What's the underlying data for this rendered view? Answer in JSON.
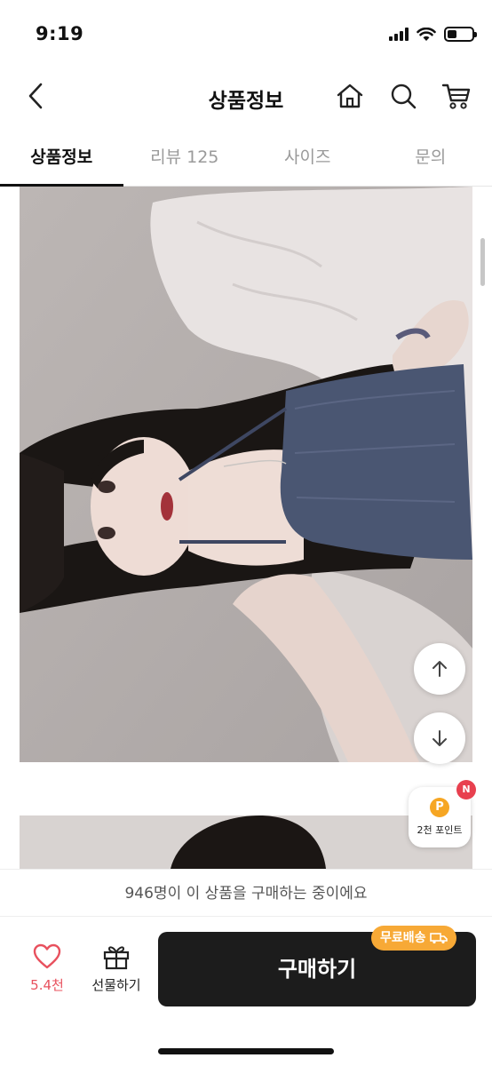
{
  "status_bar": {
    "time": "9:19"
  },
  "header": {
    "title": "상품정보"
  },
  "tabs": [
    {
      "label": "상품정보",
      "active": true
    },
    {
      "label": "리뷰 125",
      "active": false
    },
    {
      "label": "사이즈",
      "active": false
    },
    {
      "label": "문의",
      "active": false
    }
  ],
  "floating": {
    "points_label": "2천 포인트",
    "points_coin": "P",
    "new_badge": "N"
  },
  "notice": {
    "text": "946명이 이 상품을 구매하는 중이에요"
  },
  "bottom": {
    "like_count": "5.4천",
    "gift_label": "선물하기",
    "buy_label": "구매하기",
    "free_shipping": "무료배송"
  },
  "colors": {
    "accent_pink": "#e8515e",
    "buy_button": "#1c1c1c",
    "badge_orange": "#f7a936"
  }
}
